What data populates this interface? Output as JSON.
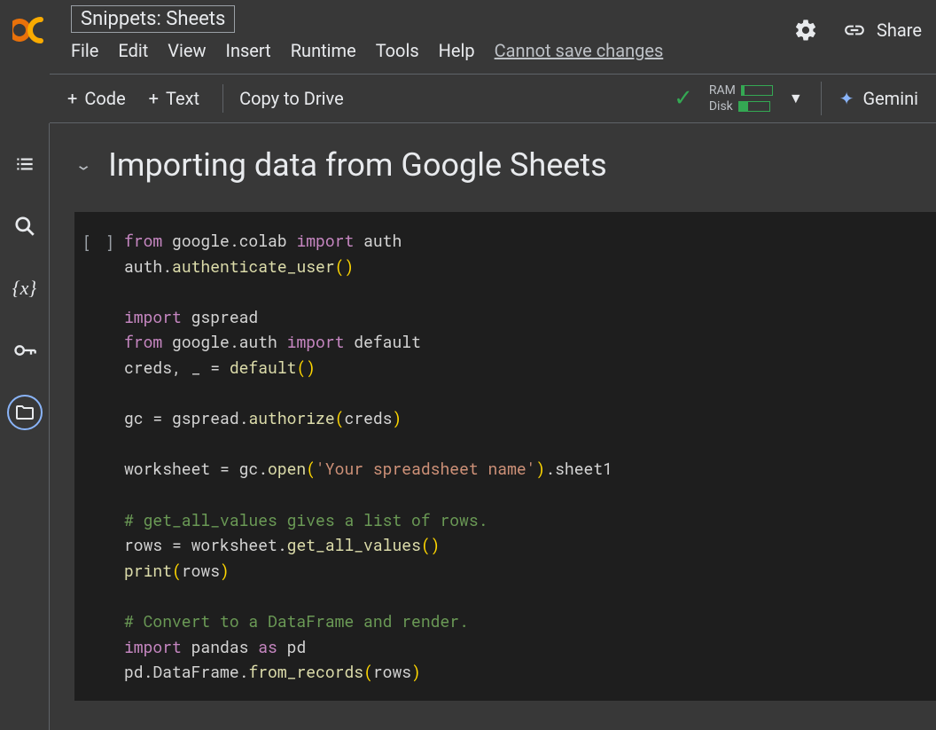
{
  "header": {
    "title": "Snippets: Sheets",
    "menus": [
      "File",
      "Edit",
      "View",
      "Insert",
      "Runtime",
      "Tools",
      "Help"
    ],
    "save_note": "Cannot save changes",
    "share_label": "Share"
  },
  "toolbar": {
    "code_label": "Code",
    "text_label": "Text",
    "copy_label": "Copy to Drive",
    "ram_label": "RAM",
    "disk_label": "Disk",
    "gemini_label": "Gemini"
  },
  "section": {
    "title": "Importing data from Google Sheets"
  },
  "cell": {
    "prompt": "[ ]",
    "code_html": "<span class='kw'>from</span> google.colab <span class='kw'>import</span> auth\nauth.<span class='fn'>authenticate_user</span><span class='par'>()</span>\n\n<span class='kw'>import</span> gspread\n<span class='kw'>from</span> google.auth <span class='kw'>import</span> default\ncreds, _ = <span class='fn'>default</span><span class='par'>()</span>\n\ngc = gspread.<span class='fn'>authorize</span><span class='par'>(</span>creds<span class='par'>)</span>\n\nworksheet = gc.<span class='fn'>open</span><span class='par'>(</span><span class='str'>'Your spreadsheet name'</span><span class='par'>)</span>.sheet1\n\n<span class='cmt'># get_all_values gives a list of rows.</span>\nrows = worksheet.<span class='fn'>get_all_values</span><span class='par'>()</span>\n<span class='fn'>print</span><span class='par'>(</span>rows<span class='par'>)</span>\n\n<span class='cmt'># Convert to a DataFrame and render.</span>\n<span class='kw'>import</span> pandas <span class='kw'>as</span> pd\npd.DataFrame.<span class='fn'>from_records</span><span class='par'>(</span>rows<span class='par'>)</span>"
  }
}
